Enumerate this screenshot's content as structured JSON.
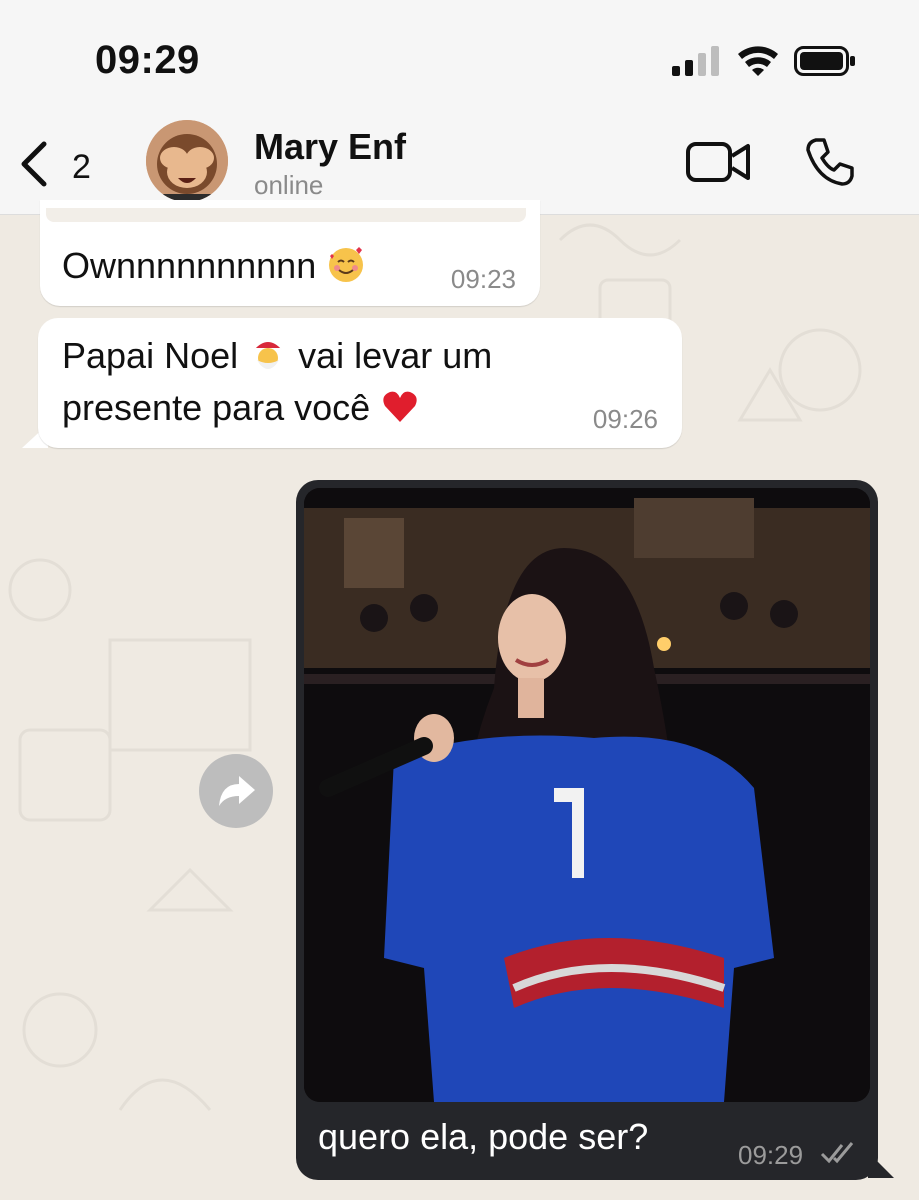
{
  "status_bar": {
    "time": "09:29"
  },
  "header": {
    "back_count": "2",
    "contact_name": "Mary Enf",
    "contact_status": "online",
    "avatar_icon": "see-no-evil-monkey"
  },
  "messages": [
    {
      "direction": "incoming",
      "text": "Ownnnnnnnnnn",
      "emoji": "smiling-face-with-hearts",
      "time": "09:23"
    },
    {
      "direction": "incoming",
      "text_part1": "Papai Noel",
      "emoji1": "santa-claus",
      "text_part2": "vai levar um presente para você",
      "emoji2": "red-heart",
      "time": "09:26"
    },
    {
      "direction": "outgoing",
      "type": "photo",
      "caption": "quero ela, pode ser?",
      "time": "09:29",
      "status": "read"
    }
  ],
  "colors": {
    "chat_bg": "#efeae2",
    "incoming_bubble": "#ffffff",
    "outgoing_bubble": "#25262a",
    "accent_text": "#111111"
  }
}
